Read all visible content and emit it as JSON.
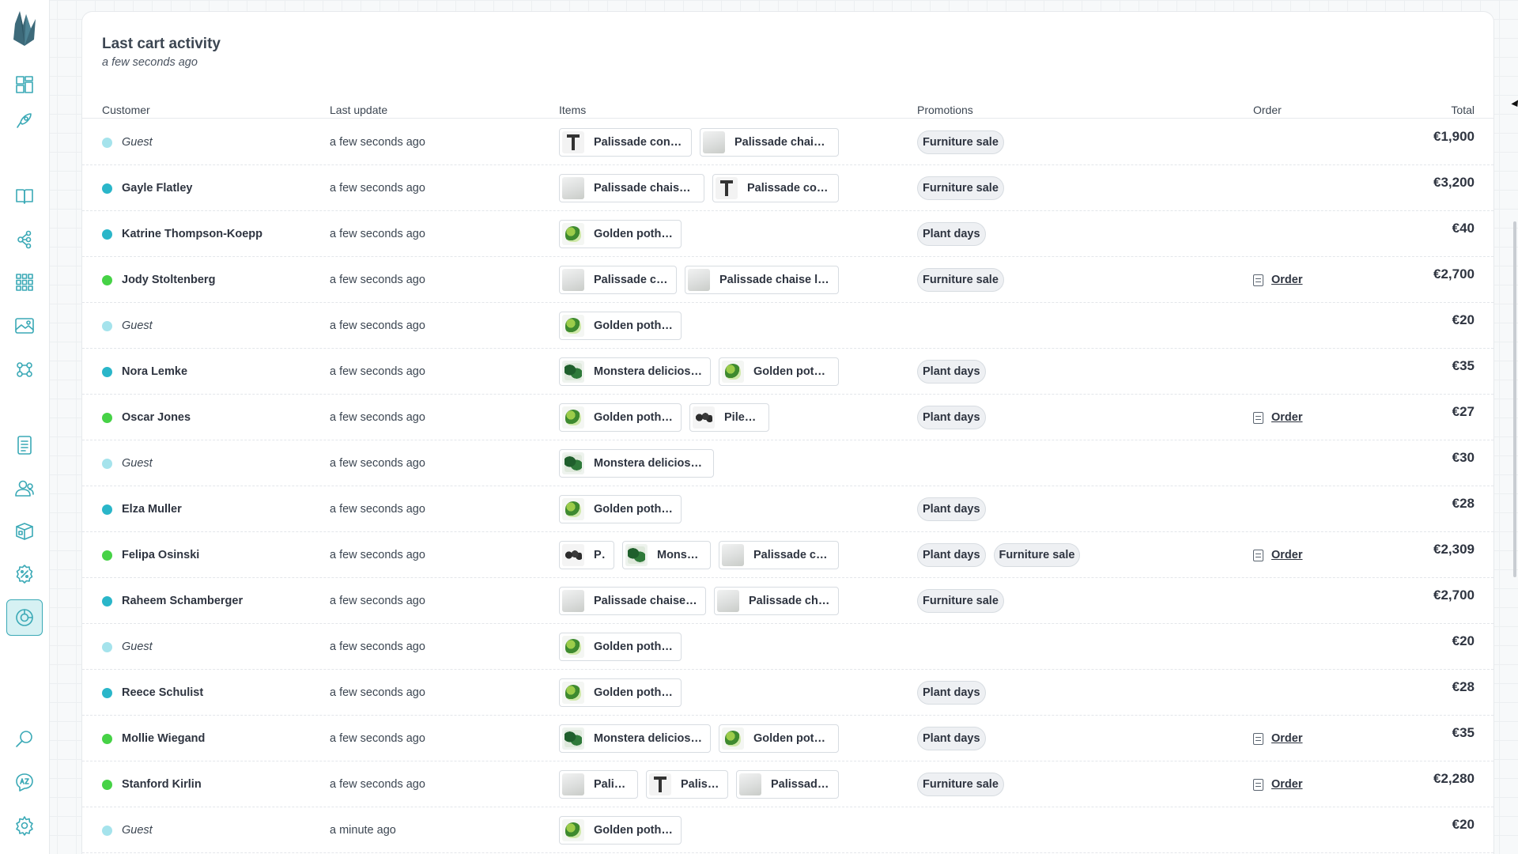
{
  "colors": {
    "accent": "#3aa9b6",
    "guest_dot": "#a5e3ec",
    "member_dot": "#2ab6c9",
    "customer_dot": "#46d246"
  },
  "sidebar": {
    "items": [
      {
        "name": "dashboard-icon"
      },
      {
        "name": "rocket-icon"
      },
      {
        "name": "catalog-book-icon"
      },
      {
        "name": "categories-tree-icon"
      },
      {
        "name": "grid-icon"
      },
      {
        "name": "media-image-icon"
      },
      {
        "name": "attributes-icon"
      },
      {
        "name": "orders-list-icon"
      },
      {
        "name": "customers-icon"
      },
      {
        "name": "inventory-box-icon"
      },
      {
        "name": "promotions-percent-icon"
      },
      {
        "name": "analytics-icon"
      },
      {
        "name": "search-icon"
      },
      {
        "name": "translations-icon"
      },
      {
        "name": "settings-gear-icon"
      }
    ]
  },
  "card": {
    "title": "Last cart activity",
    "subtitle": "a few seconds ago",
    "columns": {
      "customer": "Customer",
      "last_update": "Last update",
      "items": "Items",
      "promotions": "Promotions",
      "order": "Order",
      "total": "Total"
    }
  },
  "rows": [
    {
      "customer": "Guest",
      "guest": true,
      "dot": "guest",
      "updated": "a few seconds ago",
      "items": [
        {
          "label": "Palissade cone table...",
          "thumb": "table",
          "w": 168
        },
        {
          "label": "Palissade chaise...",
          "thumb": "chaise",
          "w": 176
        }
      ],
      "promotions": [
        "Furniture sale"
      ],
      "order": "",
      "total": "€1,900"
    },
    {
      "customer": "Gayle Flatley",
      "guest": false,
      "dot": "member",
      "updated": "a few seconds ago",
      "items": [
        {
          "label": "Palissade chaise longu...",
          "thumb": "chaise",
          "w": 184
        },
        {
          "label": "Palissade cone tabl...",
          "thumb": "table",
          "w": 160
        }
      ],
      "promotions": [
        "Furniture sale"
      ],
      "order": "",
      "total": "€3,200"
    },
    {
      "customer": "Katrine Thompson-Koepp",
      "guest": false,
      "dot": "member",
      "updated": "a few seconds ago",
      "items": [
        {
          "label": "Golden pothos large",
          "thumb": "pothos",
          "w": 155
        }
      ],
      "promotions": [
        "Plant days"
      ],
      "order": "",
      "total": "€40"
    },
    {
      "customer": "Jody Stoltenberg",
      "guest": false,
      "dot": "customer",
      "updated": "a few seconds ago",
      "items": [
        {
          "label": "Palissade chaise...",
          "thumb": "chaise",
          "w": 149
        },
        {
          "label": "Palissade chaise longue...",
          "thumb": "chaise",
          "w": 195
        }
      ],
      "promotions": [
        "Furniture sale"
      ],
      "order": "Order",
      "total": "€2,700"
    },
    {
      "customer": "Guest",
      "guest": true,
      "dot": "guest",
      "updated": "a few seconds ago",
      "items": [
        {
          "label": "Golden pothos large",
          "thumb": "pothos",
          "w": 155
        }
      ],
      "promotions": [],
      "order": "",
      "total": "€20"
    },
    {
      "customer": "Nora Lemke",
      "guest": false,
      "dot": "member",
      "updated": "a few seconds ago",
      "items": [
        {
          "label": "Monstera deliciosa...",
          "thumb": "monstera",
          "w": 192
        },
        {
          "label": "Golden pothos...",
          "thumb": "pothos",
          "w": 152
        }
      ],
      "promotions": [
        "Plant days"
      ],
      "order": "",
      "total": "€35"
    },
    {
      "customer": "Oscar Jones",
      "guest": false,
      "dot": "customer",
      "updated": "a few seconds ago",
      "items": [
        {
          "label": "Golden pothos large",
          "thumb": "pothos",
          "w": 155
        },
        {
          "label": "Pilea large",
          "thumb": "pilea",
          "w": 101
        }
      ],
      "promotions": [
        "Plant days"
      ],
      "order": "Order",
      "total": "€27"
    },
    {
      "customer": "Guest",
      "guest": true,
      "dot": "guest",
      "updated": "a few seconds ago",
      "items": [
        {
          "label": "Monstera deliciosa medium",
          "thumb": "monstera",
          "w": 196
        }
      ],
      "promotions": [],
      "order": "",
      "total": "€30"
    },
    {
      "customer": "Elza Muller",
      "guest": false,
      "dot": "member",
      "updated": "a few seconds ago",
      "items": [
        {
          "label": "Golden pothos large",
          "thumb": "pothos",
          "w": 155
        }
      ],
      "promotions": [
        "Plant days"
      ],
      "order": "",
      "total": "€28"
    },
    {
      "customer": "Felipa Osinski",
      "guest": false,
      "dot": "customer",
      "updated": "a few seconds ago",
      "items": [
        {
          "label": "Pil...",
          "thumb": "pilea",
          "w": 70
        },
        {
          "label": "Monstera...",
          "thumb": "monstera",
          "w": 112
        },
        {
          "label": "Palissade chaise...",
          "thumb": "chaise",
          "w": 152
        }
      ],
      "promotions": [
        "Plant days",
        "Furniture sale"
      ],
      "order": "Order",
      "total": "€2,309"
    },
    {
      "customer": "Raheem Schamberger",
      "guest": false,
      "dot": "member",
      "updated": "a few seconds ago",
      "items": [
        {
          "label": "Palissade chaise longue...",
          "thumb": "chaise",
          "w": 186
        },
        {
          "label": "Palissade chaise...",
          "thumb": "chaise",
          "w": 158
        }
      ],
      "promotions": [
        "Furniture sale"
      ],
      "order": "",
      "total": "€2,700"
    },
    {
      "customer": "Guest",
      "guest": true,
      "dot": "guest",
      "updated": "a few seconds ago",
      "items": [
        {
          "label": "Golden pothos large",
          "thumb": "pothos",
          "w": 155
        }
      ],
      "promotions": [],
      "order": "",
      "total": "€20"
    },
    {
      "customer": "Reece Schulist",
      "guest": false,
      "dot": "member",
      "updated": "a few seconds ago",
      "items": [
        {
          "label": "Golden pothos large",
          "thumb": "pothos",
          "w": 155
        }
      ],
      "promotions": [
        "Plant days"
      ],
      "order": "",
      "total": "€28"
    },
    {
      "customer": "Mollie Wiegand",
      "guest": false,
      "dot": "customer",
      "updated": "a few seconds ago",
      "items": [
        {
          "label": "Monstera deliciosa...",
          "thumb": "monstera",
          "w": 192
        },
        {
          "label": "Golden pothos...",
          "thumb": "pothos",
          "w": 152
        }
      ],
      "promotions": [
        "Plant days"
      ],
      "order": "Order",
      "total": "€35"
    },
    {
      "customer": "Stanford Kirlin",
      "guest": false,
      "dot": "customer",
      "updated": "a few seconds ago",
      "items": [
        {
          "label": "Palissad...",
          "thumb": "chaise",
          "w": 100
        },
        {
          "label": "Palissad...",
          "thumb": "table",
          "w": 104
        },
        {
          "label": "Palissade...",
          "thumb": "chaise",
          "w": 130
        }
      ],
      "promotions": [
        "Furniture sale"
      ],
      "order": "Order",
      "total": "€2,280"
    },
    {
      "customer": "Guest",
      "guest": true,
      "dot": "guest",
      "updated": "a minute ago",
      "items": [
        {
          "label": "Golden pothos large",
          "thumb": "pothos",
          "w": 155
        }
      ],
      "promotions": [],
      "order": "",
      "total": "€20"
    }
  ]
}
